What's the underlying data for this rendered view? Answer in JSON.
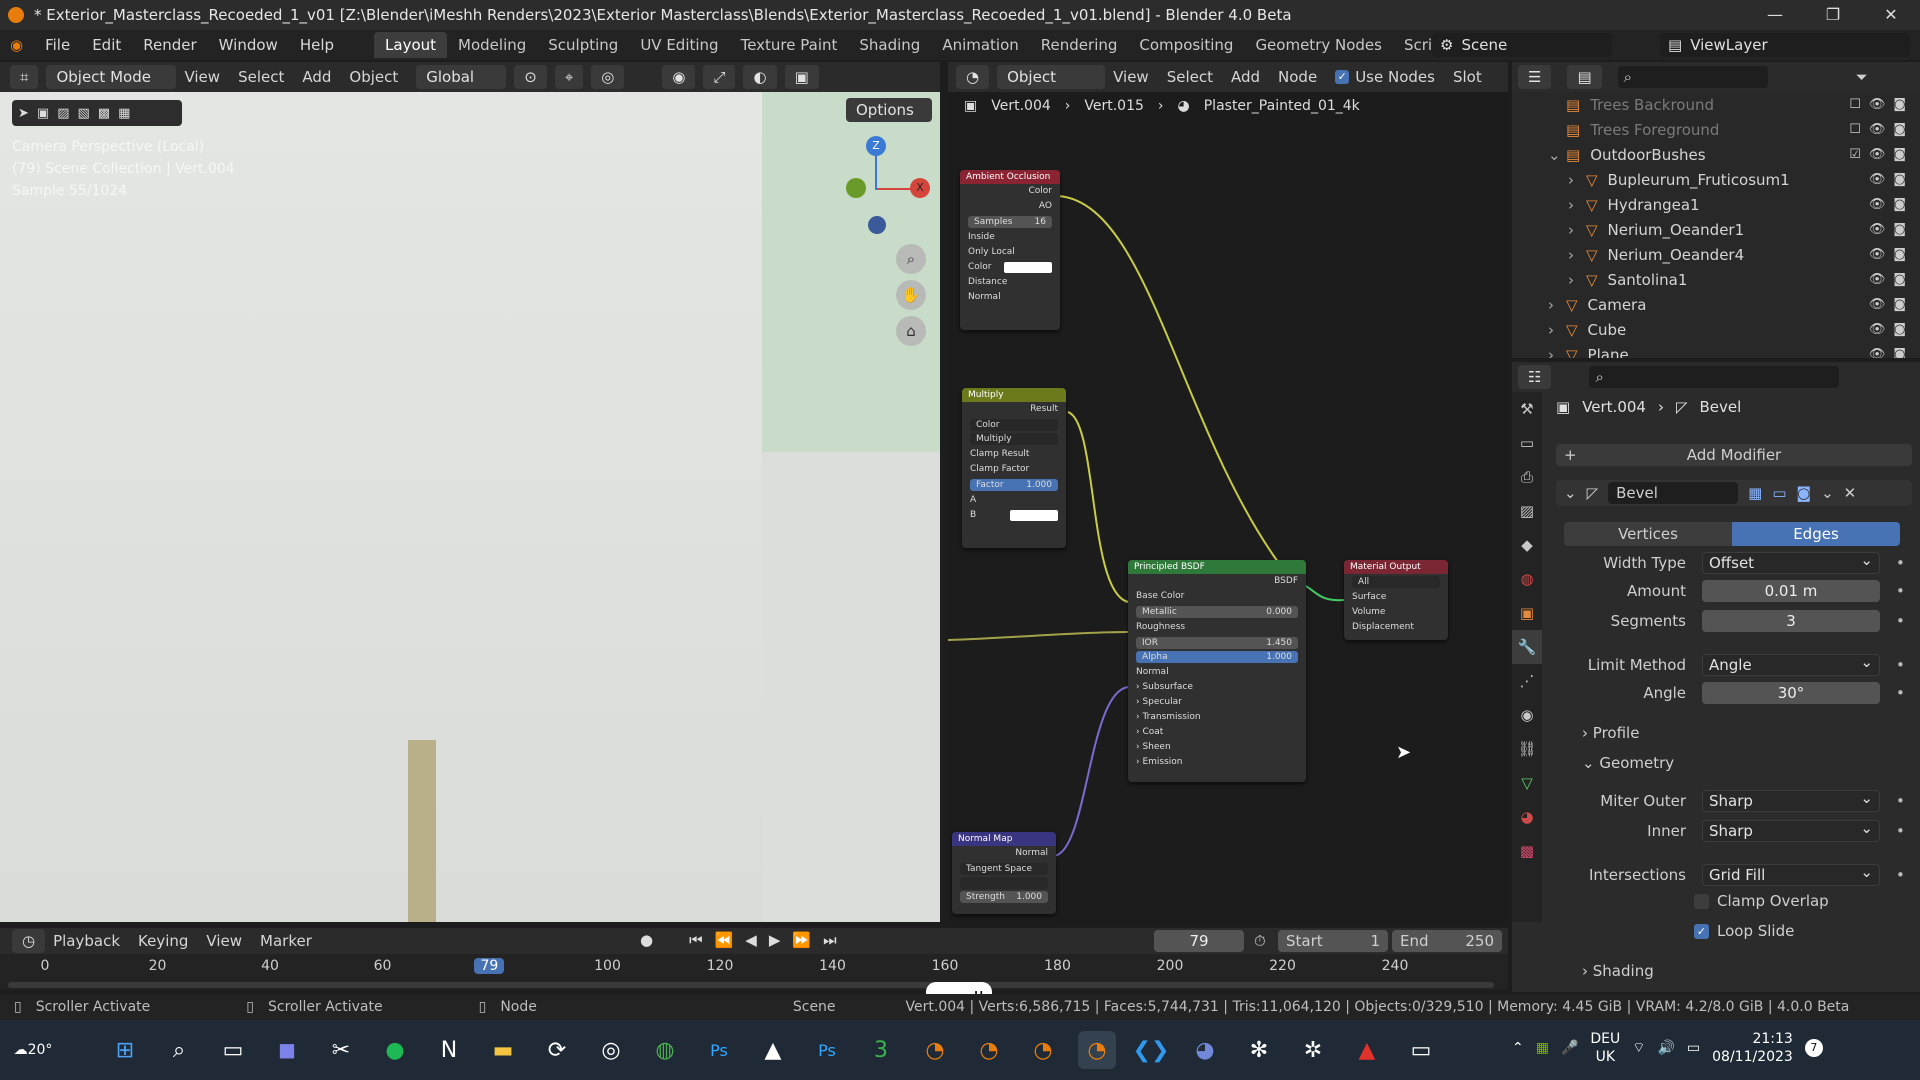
{
  "title": "* Exterior_Masterclass_Recoeded_1_v01 [Z:\\Blender\\iMeshh Renders\\2023\\Exterior Masterclass\\Blends\\Exterior_Masterclass_Recoeded_1_v01.blend] - Blender 4.0 Beta",
  "menu": [
    "File",
    "Edit",
    "Render",
    "Window",
    "Help"
  ],
  "workspaces": [
    "Layout",
    "Modeling",
    "Sculpting",
    "UV Editing",
    "Texture Paint",
    "Shading",
    "Animation",
    "Rendering",
    "Compositing",
    "Geometry Nodes",
    "Scripting",
    "+"
  ],
  "scene": "Scene",
  "view_layer": "ViewLayer",
  "viewport": {
    "mode": "Object Mode",
    "menus": [
      "View",
      "Select",
      "Add",
      "Object"
    ],
    "transform": "Global",
    "options": "Options",
    "overlay_line1": "Camera Perspective (Local)",
    "overlay_line2": "(79) Scene Collection | Vert.004",
    "overlay_line3": "Sample 55/1024",
    "axis_z": "Z",
    "axis_x": "X"
  },
  "node_header": {
    "type": "Object",
    "menus": [
      "View",
      "Select",
      "Add",
      "Node"
    ],
    "use_nodes": "Use Nodes",
    "slot": "Slot",
    "breadcrumb": [
      "Vert.004",
      "Vert.015",
      "Plaster_Painted_01_4k"
    ]
  },
  "nodes": {
    "ao": {
      "title": "Ambient Occlusion",
      "out1": "Color",
      "out2": "AO",
      "samples_label": "Samples",
      "samples": "16",
      "inside": "Inside",
      "only_local": "Only Local",
      "in1": "Color",
      "in2": "Distance",
      "in3": "Normal"
    },
    "multiply": {
      "title": "Multiply",
      "out": "Result",
      "type": "Color",
      "op": "Multiply",
      "clamp_result": "Clamp Result",
      "clamp_factor": "Clamp Factor",
      "factor_label": "Factor",
      "factor": "1.000",
      "a": "A",
      "b": "B"
    },
    "bsdf": {
      "title": "Principled BSDF",
      "out": "BSDF",
      "base_color": "Base Color",
      "metallic_label": "Metallic",
      "metallic": "0.000",
      "roughness": "Roughness",
      "ior_label": "IOR",
      "ior": "1.450",
      "alpha_label": "Alpha",
      "alpha": "1.000",
      "normal": "Normal",
      "subs": [
        "Subsurface",
        "Specular",
        "Transmission",
        "Coat",
        "Sheen",
        "Emission"
      ]
    },
    "output": {
      "title": "Material Output",
      "target": "All",
      "surface": "Surface",
      "volume": "Volume",
      "displacement": "Displacement"
    },
    "normal_map": {
      "title": "Normal Map",
      "out": "Normal",
      "space": "Tangent Space",
      "strength_label": "Strength",
      "strength": "1.000"
    }
  },
  "outliner": [
    {
      "name": "Trees Backround",
      "indent": 1
    },
    {
      "name": "Trees Foreground",
      "indent": 1
    },
    {
      "name": "OutdoorBushes",
      "indent": 1
    },
    {
      "name": "Bupleurum_Fruticosum1",
      "indent": 2
    },
    {
      "name": "Hydrangea1",
      "indent": 2
    },
    {
      "name": "Nerium_Oeander1",
      "indent": 2
    },
    {
      "name": "Nerium_Oeander4",
      "indent": 2
    },
    {
      "name": "Santolina1",
      "indent": 2
    },
    {
      "name": "Camera",
      "indent": 1
    },
    {
      "name": "Cube",
      "indent": 1
    },
    {
      "name": "Plane",
      "indent": 1
    }
  ],
  "properties": {
    "breadcrumb_obj": "Vert.004",
    "breadcrumb_mod": "Bevel",
    "add_modifier": "Add Modifier",
    "modifier_name": "Bevel",
    "tab_vertices": "Vertices",
    "tab_edges": "Edges",
    "width_type_label": "Width Type",
    "width_type": "Offset",
    "amount_label": "Amount",
    "amount": "0.01 m",
    "segments_label": "Segments",
    "segments": "3",
    "limit_method_label": "Limit Method",
    "limit_method": "Angle",
    "angle_label": "Angle",
    "angle": "30°",
    "profile": "Profile",
    "geometry": "Geometry",
    "miter_outer_label": "Miter Outer",
    "miter_outer": "Sharp",
    "inner_label": "Inner",
    "inner": "Sharp",
    "intersections_label": "Intersections",
    "intersections": "Grid Fill",
    "clamp_overlap": "Clamp Overlap",
    "loop_slide": "Loop Slide",
    "shading": "Shading"
  },
  "timeline": {
    "menus": [
      "Playback",
      "Keying",
      "View",
      "Marker"
    ],
    "current_frame": "79",
    "start_label": "Start",
    "start": "1",
    "end_label": "End",
    "end": "250",
    "ticks": [
      "0",
      "20",
      "40",
      "60",
      "79",
      "100",
      "120",
      "140",
      "160",
      "180",
      "200",
      "220",
      "240"
    ]
  },
  "scroll_tooltip": "scroll",
  "status": {
    "left1": "Scroller Activate",
    "left2": "Scroller Activate",
    "left3": "Node",
    "scene": "Scene",
    "stats": "Vert.004 | Verts:6,586,715 | Faces:5,744,731 | Tris:11,064,120 | Objects:0/329,510 | Memory: 4.45 GiB | VRAM: 4.2/8.0 GiB | 4.0.0 Beta"
  },
  "taskbar": {
    "weather": "20°",
    "lang1": "DEU",
    "lang2": "UK",
    "time": "21:13",
    "date": "08/11/2023",
    "badge": "7"
  }
}
